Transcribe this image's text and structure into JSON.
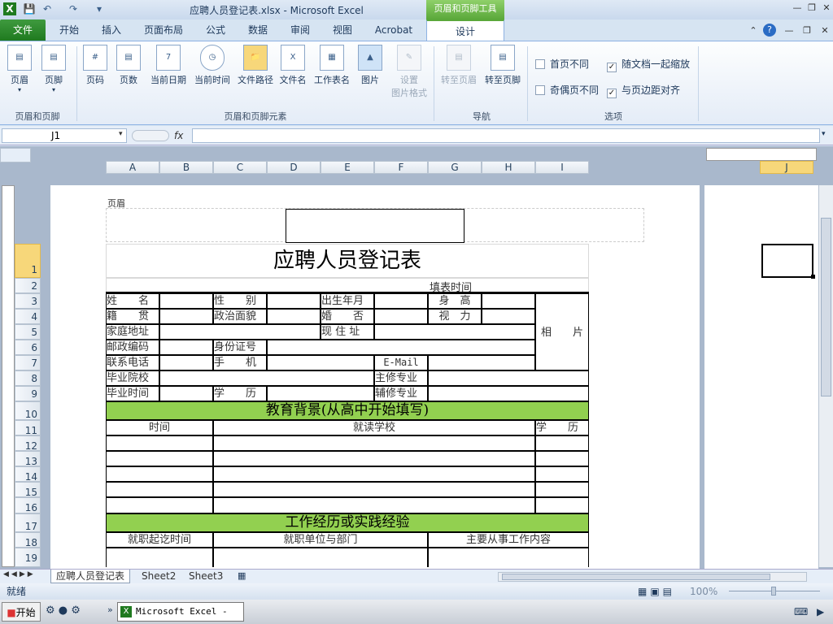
{
  "window": {
    "title": "应聘人员登记表.xlsx - Microsoft Excel",
    "context_tab_header": "页眉和页脚工具"
  },
  "tabs": [
    "文件",
    "开始",
    "插入",
    "页面布局",
    "公式",
    "数据",
    "审阅",
    "视图",
    "Acrobat",
    "设计"
  ],
  "ribbon": {
    "group1": {
      "label": "页眉和页脚",
      "buttons": [
        "页眉",
        "页脚"
      ]
    },
    "group2": {
      "label": "页眉和页脚元素",
      "buttons": [
        "页码",
        "页数",
        "当前日期",
        "当前时间",
        "文件路径",
        "文件名",
        "工作表名",
        "图片"
      ],
      "format_line1": "设置",
      "format_line2": "图片格式"
    },
    "group3": {
      "label": "导航",
      "buttons": [
        "转至页眉",
        "转至页脚"
      ]
    },
    "group4": {
      "label": "选项",
      "checkboxes": [
        {
          "label": "首页不同",
          "checked": false
        },
        {
          "label": "随文档一起缩放",
          "checked": true
        },
        {
          "label": "奇偶页不同",
          "checked": false
        },
        {
          "label": "与页边距对齐",
          "checked": true
        }
      ]
    }
  },
  "formula": {
    "name_box": "J1",
    "fx": "fx",
    "value": ""
  },
  "columns": [
    "A",
    "B",
    "C",
    "D",
    "E",
    "F",
    "G",
    "H",
    "I",
    "J"
  ],
  "rows": [
    "1",
    "2",
    "3",
    "4",
    "5",
    "6",
    "7",
    "8",
    "9",
    "10",
    "11",
    "12",
    "13",
    "14",
    "15",
    "16",
    "17",
    "18",
    "19"
  ],
  "sheet": {
    "header_label": "页眉",
    "title": "应聘人员登记表",
    "fill_time": "填表时间",
    "r3": [
      "姓　　名",
      "性　　别",
      "出生年月",
      "身　高"
    ],
    "r4": [
      "籍　　贯",
      "政治面貌",
      "婚　　否",
      "视　力"
    ],
    "photo": "相　　片",
    "r5": [
      "家庭地址",
      "现 住 址"
    ],
    "r6": [
      "邮政编码",
      "身份证号"
    ],
    "r7": [
      "联系电话",
      "手　　机",
      "E-Mail"
    ],
    "r8": [
      "毕业院校",
      "主修专业"
    ],
    "r9": [
      "毕业时间",
      "学　　历",
      "辅修专业"
    ],
    "section1": "教育背景(从高中开始填写)",
    "r11": [
      "时间",
      "就读学校",
      "学　　历"
    ],
    "section2": "工作经历或实践经验",
    "r18": [
      "就职起讫时间",
      "就职单位与部门",
      "主要从事工作内容"
    ]
  },
  "sheet_tabs": [
    "应聘人员登记表",
    "Sheet2",
    "Sheet3"
  ],
  "status": {
    "ready": "就绪",
    "zoom": "100%"
  },
  "taskbar": {
    "start": "开始",
    "app": "Microsoft Excel - ..."
  },
  "colors": {
    "section_fill": "#92d050",
    "file_tab": "#1f7a1f",
    "selected_header": "#f7d77a"
  }
}
